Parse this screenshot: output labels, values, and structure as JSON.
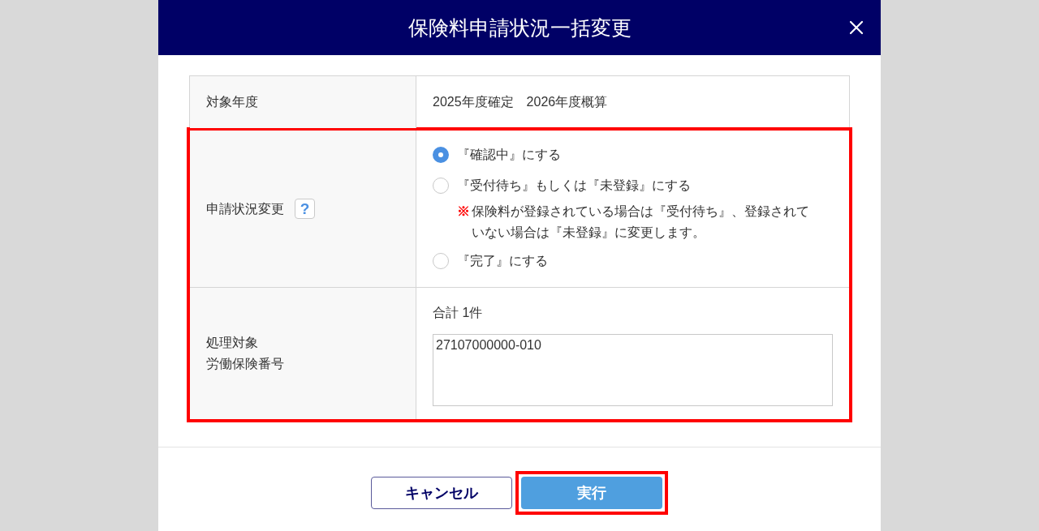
{
  "dialog": {
    "title": "保険料申請状況一括変更"
  },
  "form": {
    "rows": [
      {
        "kind": "text",
        "label": [
          "対象年度"
        ],
        "value": "2025年度確定　2026年度概算",
        "highlighted": false
      },
      {
        "kind": "radio",
        "label": [
          "申請状況変更"
        ],
        "help": "?",
        "highlighted": true,
        "options": [
          {
            "label": "『確認中』にする",
            "selected": true
          },
          {
            "label": "『受付待ち』もしくは『未登録』にする",
            "selected": false,
            "note": {
              "mark": "※",
              "text": "保険料が登録されている場合は『受付待ち』、登録されていない場合は『未登録』に変更します。"
            }
          },
          {
            "label": "『完了』にする",
            "selected": false
          }
        ]
      },
      {
        "kind": "textarea",
        "label": [
          "処理対象",
          "労働保険番号"
        ],
        "count": "合計 1件",
        "value": "27107000000-010",
        "highlighted": true
      }
    ]
  },
  "footer": {
    "buttons": [
      {
        "kind": "secondary",
        "label": "キャンセル",
        "highlighted": false
      },
      {
        "kind": "primary",
        "label": "実行",
        "highlighted": true
      }
    ]
  }
}
